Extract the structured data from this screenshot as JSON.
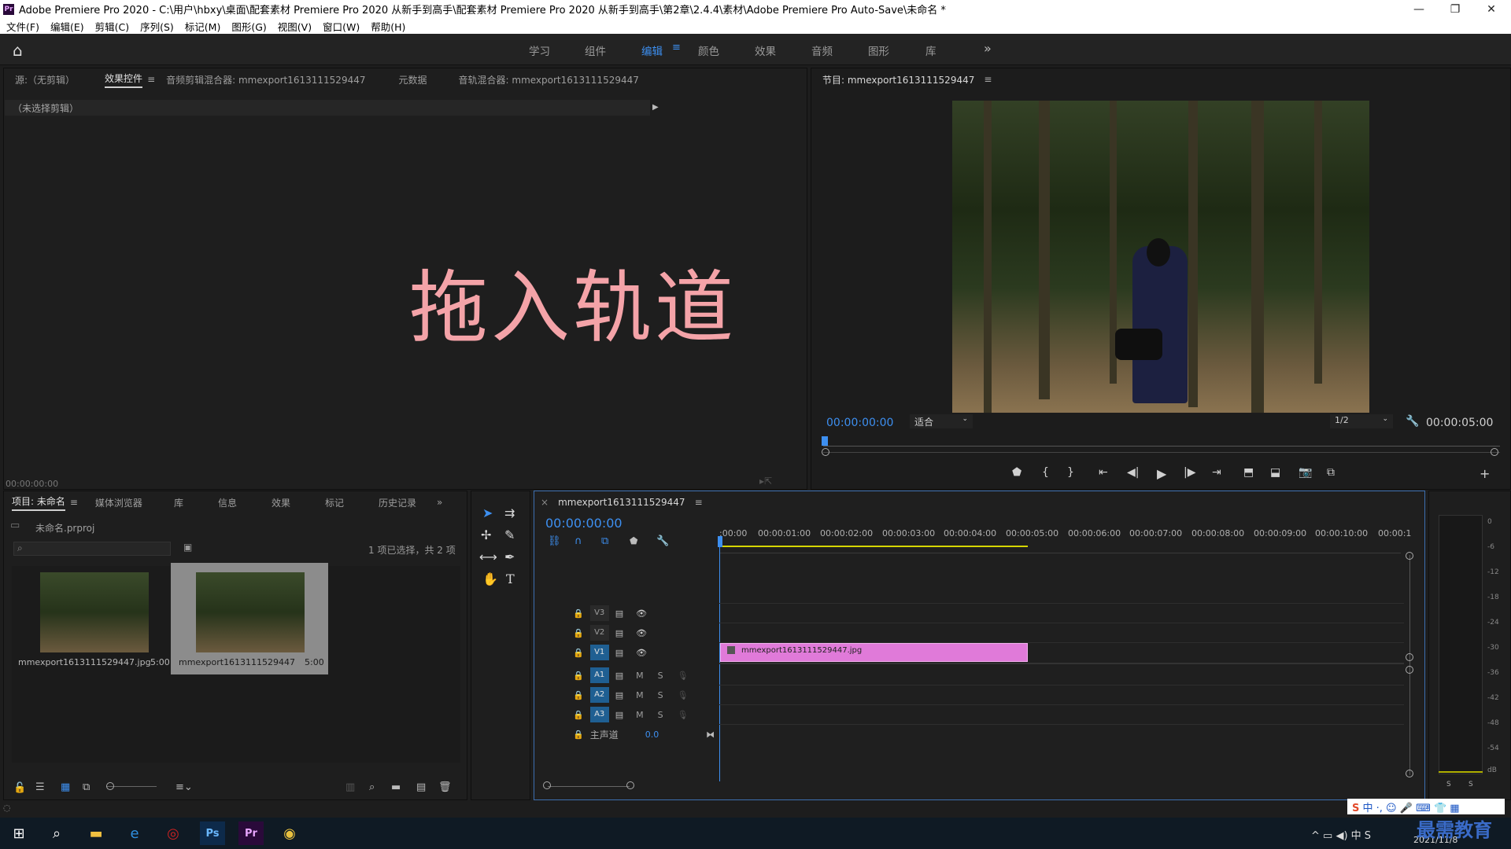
{
  "window": {
    "title": "Adobe Premiere Pro 2020 - C:\\用户\\hbxy\\桌面\\配套素材 Premiere Pro 2020 从新手到高手\\配套素材 Premiere Pro 2020 从新手到高手\\第2章\\2.4.4\\素材\\Adobe Premiere Pro Auto-Save\\未命名 *",
    "logo_text": "Pr"
  },
  "menu": [
    "文件(F)",
    "编辑(E)",
    "剪辑(C)",
    "序列(S)",
    "标记(M)",
    "图形(G)",
    "视图(V)",
    "窗口(W)",
    "帮助(H)"
  ],
  "workspaces": [
    "学习",
    "组件",
    "编辑",
    "颜色",
    "效果",
    "音频",
    "图形",
    "库"
  ],
  "workspace_active": "编辑",
  "source_panel": {
    "tabs": [
      "源:（无剪辑）",
      "效果控件",
      "音频剪辑混合器: mmexport1613111529447",
      "元数据",
      "音轨混合器: mmexport1613111529447"
    ],
    "no_clip_text": "（未选择剪辑）",
    "timecode": "00:00:00:00",
    "overlay_text": "拖入轨道"
  },
  "program_monitor": {
    "title": "节目: mmexport1613111529447",
    "timecode_current": "00:00:00:00",
    "fit_option": "适合",
    "resolution": "1/2",
    "timecode_duration": "00:00:05:00"
  },
  "project_panel": {
    "tabs": [
      "项目: 未命名",
      "媒体浏览器",
      "库",
      "信息",
      "效果",
      "标记",
      "历史记录"
    ],
    "file_name": "未命名.prproj",
    "selection_status": "1 项已选择，共 2 项",
    "items": [
      {
        "name": "mmexport1613111529447.jpg",
        "duration": "5:00"
      },
      {
        "name": "mmexport1613111529447",
        "duration": "5:00"
      }
    ]
  },
  "timeline": {
    "sequence_name": "mmexport1613111529447",
    "timecode": "00:00:00:00",
    "ruler": [
      ":00:00",
      "00:00:01:00",
      "00:00:02:00",
      "00:00:03:00",
      "00:00:04:00",
      "00:00:05:00",
      "00:00:06:00",
      "00:00:07:00",
      "00:00:08:00",
      "00:00:09:00",
      "00:00:10:00",
      "00:00:1"
    ],
    "video_tracks": [
      "V3",
      "V2",
      "V1"
    ],
    "audio_tracks": [
      "A1",
      "A2",
      "A3"
    ],
    "master_label": "主声道",
    "master_value": "0.0",
    "clip_name": "mmexport1613111529447.jpg",
    "track_m": "M",
    "track_s": "S"
  },
  "audio_meter": {
    "scale": [
      "0",
      "-6",
      "-12",
      "-18",
      "-24",
      "-30",
      "-36",
      "-42",
      "-48",
      "-54",
      "dB"
    ],
    "solo": [
      "S",
      "S"
    ]
  },
  "taskbar": {
    "date": "2021/11/8",
    "ime": "中",
    "watermark": "最需教育"
  }
}
